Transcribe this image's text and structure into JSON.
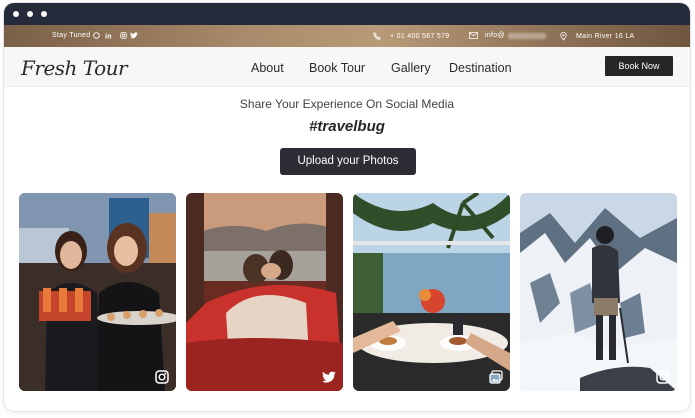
{
  "topbar": {
    "social_label": "Stay Tuned",
    "phone": "+ 01 400 567 579",
    "email": "info@",
    "address": "Main River 16 LA"
  },
  "nav": {
    "logo": "Fresh Tour",
    "links": [
      "About",
      "Book Tour",
      "Gallery",
      "Destination"
    ],
    "cta": "Book Now"
  },
  "section": {
    "subtitle": "Share Your Experience On Social Media",
    "hashtag": "#travelbug",
    "upload_label": "Upload your Photos"
  },
  "gallery": [
    {
      "scene": "two women holding drinks and food platter",
      "source_icon": "instagram-icon"
    },
    {
      "scene": "couple relaxing in camper van by the lake",
      "source_icon": "twitter-icon"
    },
    {
      "scene": "breakfast table by the sea with palm trees",
      "source_icon": "gallery-icon"
    },
    {
      "scene": "hiker standing on snowy mountain ridge",
      "source_icon": "instagram-icon"
    }
  ],
  "colors": {
    "titlebar": "#252a3a",
    "topbar": "#a98a6a",
    "button": "#262626"
  }
}
